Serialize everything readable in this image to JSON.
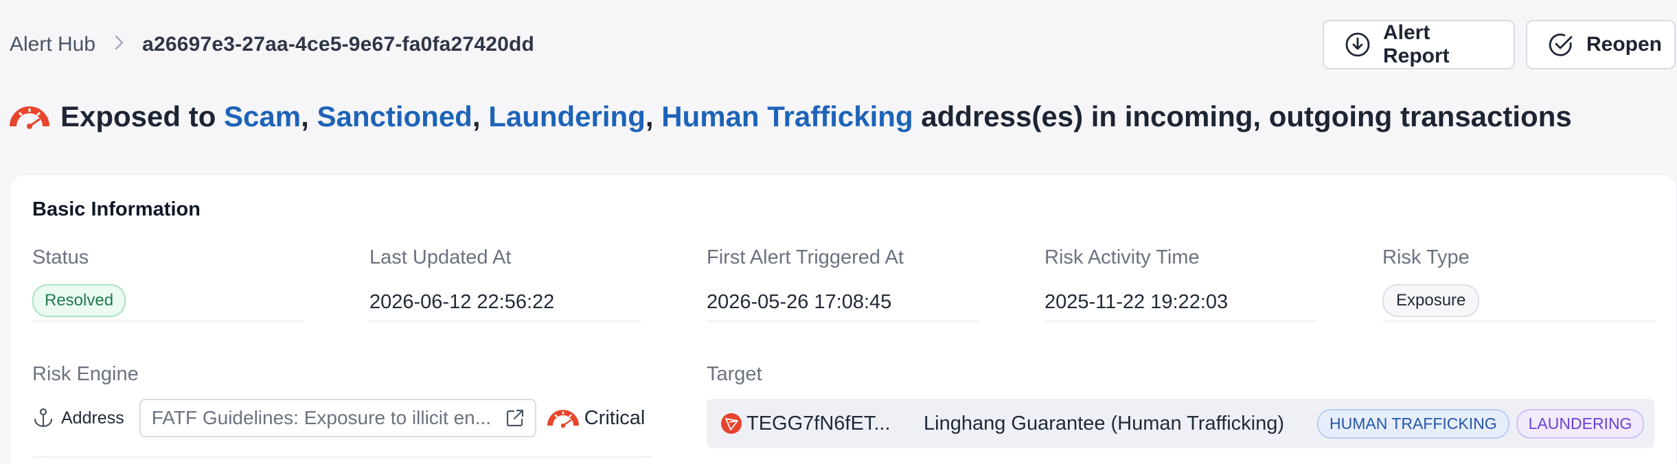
{
  "breadcrumb": {
    "root": "Alert Hub",
    "separator": ">",
    "current": "a26697e3-27aa-4ce5-9e67-fa0fa27420dd"
  },
  "actions": {
    "report_label": "Alert Report",
    "reopen_label": "Reopen"
  },
  "title": {
    "prefix": "Exposed to",
    "categories": [
      "Scam",
      "Sanctioned",
      "Laundering",
      "Human Trafficking"
    ],
    "separator": ",",
    "suffix": "address(es) in incoming, outgoing transactions"
  },
  "basic_info": {
    "heading": "Basic Information",
    "status": {
      "label": "Status",
      "value": "Resolved"
    },
    "last_updated": {
      "label": "Last Updated At",
      "value": "2026-06-12 22:56:22"
    },
    "first_alert": {
      "label": "First Alert Triggered At",
      "value": "2026-05-26 17:08:45"
    },
    "risk_activity": {
      "label": "Risk Activity Time",
      "value": "2025-11-22 19:22:03"
    },
    "risk_type": {
      "label": "Risk Type",
      "value": "Exposure"
    },
    "risk_engine": {
      "label": "Risk Engine",
      "scope": "Address",
      "rule": "FATF Guidelines: Exposure to illicit en...",
      "severity": "Critical"
    },
    "target": {
      "label": "Target",
      "address": "TEGG7fN6fET...",
      "entity": "Linghang Guarantee (Human Trafficking)",
      "tags": [
        "HUMAN TRAFFICKING",
        "LAUNDERING"
      ]
    }
  },
  "colors": {
    "link_blue": "#1d63b8",
    "critical_red": "#e8452c",
    "resolved_green": "#1c7a4d"
  },
  "icons": {
    "report": "download-circle-icon",
    "reopen": "check-circle-icon",
    "severity": "gauge-icon",
    "address": "anchor-icon",
    "external": "external-link-icon",
    "chain": "tron-icon"
  }
}
